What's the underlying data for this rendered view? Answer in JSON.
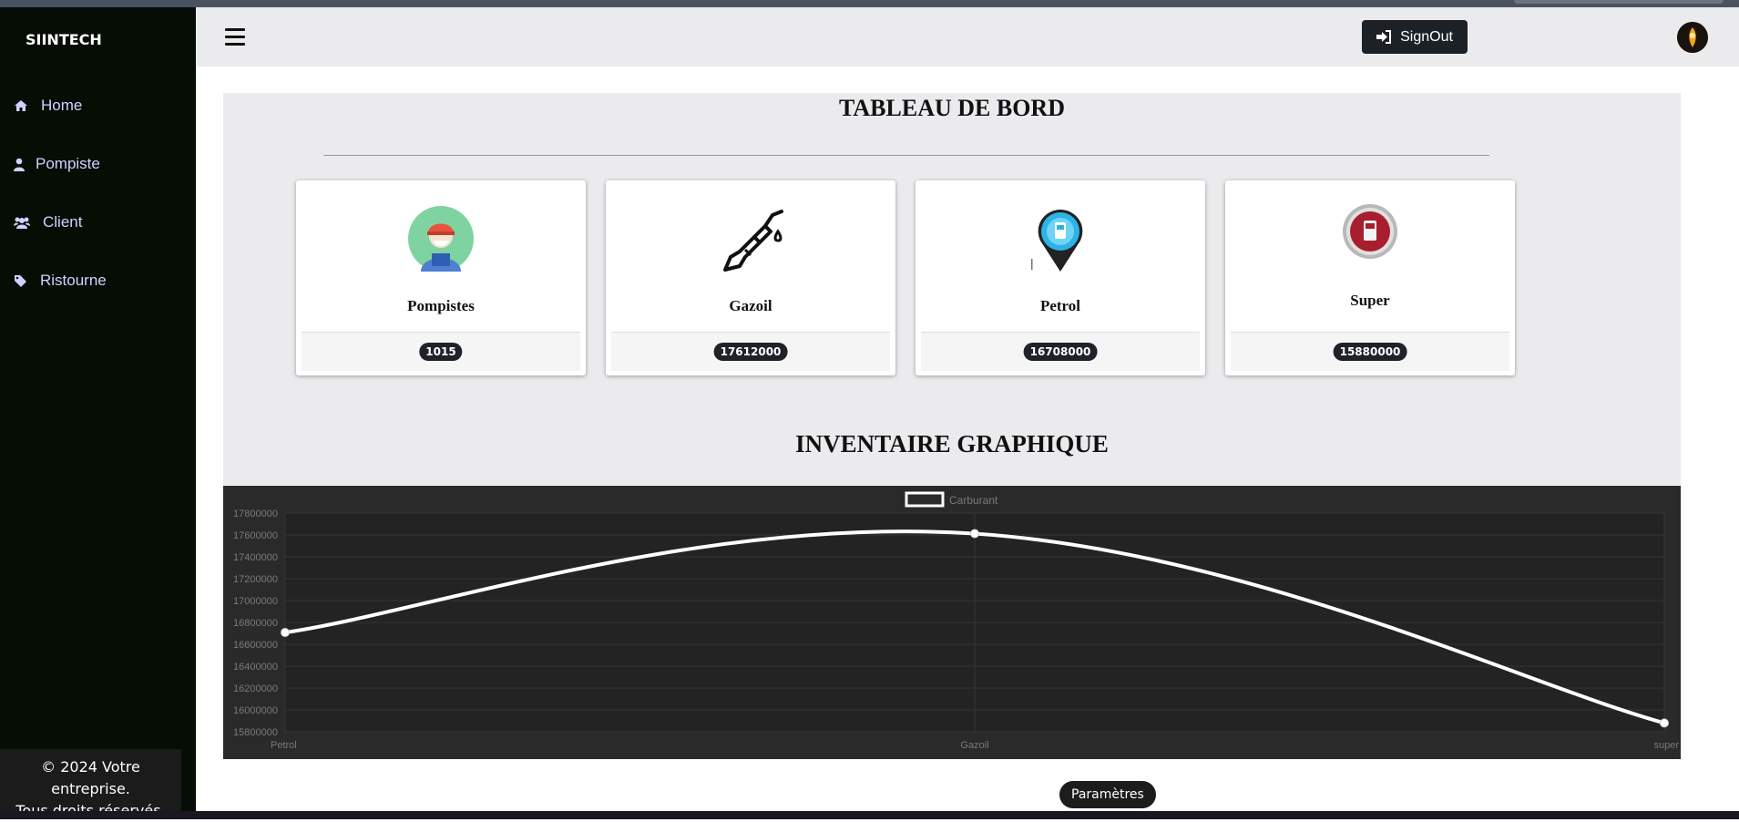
{
  "brand": "SIINTECH",
  "sidebar": {
    "items": [
      {
        "label": "Home",
        "icon": "home-icon"
      },
      {
        "label": "Pompiste",
        "icon": "user-icon"
      },
      {
        "label": "Client",
        "icon": "users-icon"
      },
      {
        "label": "Ristourne",
        "icon": "tag-icon"
      }
    ],
    "footer_line1": "© 2024 Votre entreprise.",
    "footer_line2": "Tous droits réservés."
  },
  "topbar": {
    "signout_label": "SignOut"
  },
  "dashboard": {
    "title": "TABLEAU DE BORD",
    "cards": [
      {
        "name": "Pompistes",
        "value": "1015",
        "icon": "pump-attendant-icon"
      },
      {
        "name": "Gazoil",
        "value": "17612000",
        "icon": "fuel-nozzle-icon"
      },
      {
        "name": "Petrol",
        "value": "16708000",
        "icon": "petrol-pin-icon"
      },
      {
        "name": "Super",
        "value": "15880000",
        "icon": "super-pump-icon"
      }
    ]
  },
  "inventory_title": "INVENTAIRE GRAPHIQUE",
  "params_label": "Paramètres",
  "colors": {
    "sidebar": "#050d05",
    "chart_bg": "#2a2a2a",
    "line": "#ffffff",
    "badge": "#1f2329"
  },
  "chart_data": {
    "type": "line",
    "categories": [
      "Petrol",
      "Gazoil",
      "super"
    ],
    "series": [
      {
        "name": "Carburant",
        "values": [
          16708000,
          17612000,
          15880000
        ]
      }
    ],
    "ylim": [
      15800000,
      17800000
    ],
    "yticks": [
      15800000,
      16000000,
      16200000,
      16400000,
      16600000,
      16800000,
      17000000,
      17200000,
      17400000,
      17600000,
      17800000
    ],
    "legend": "top-center",
    "grid": true
  }
}
